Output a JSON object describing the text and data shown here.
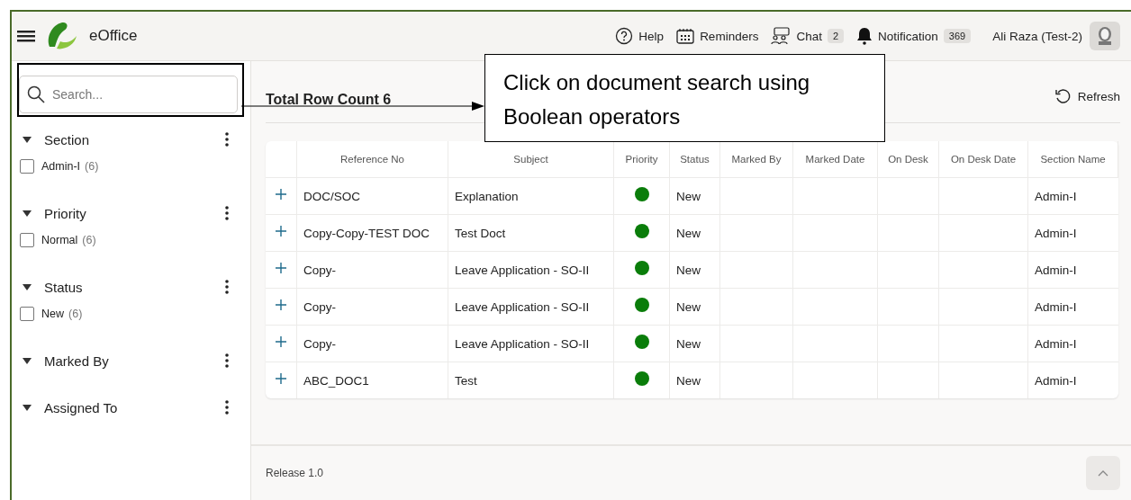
{
  "header": {
    "app_name": "eOffice",
    "nav": [
      {
        "kind": "help",
        "label": "Help"
      },
      {
        "kind": "reminders",
        "label": "Reminders"
      },
      {
        "kind": "chat",
        "label": "Chat",
        "badge": "2"
      },
      {
        "kind": "notification",
        "label": "Notification",
        "badge": "369"
      }
    ],
    "user": "Ali Raza (Test-2)"
  },
  "search": {
    "placeholder": "Search..."
  },
  "filters": [
    {
      "title": "Section",
      "expanded": true,
      "options": [
        {
          "label": "Admin-I",
          "count": "(6)",
          "checked": false
        }
      ]
    },
    {
      "title": "Priority",
      "expanded": true,
      "options": [
        {
          "label": "Normal",
          "count": "(6)",
          "checked": false
        }
      ]
    },
    {
      "title": "Status",
      "expanded": true,
      "options": [
        {
          "label": "New",
          "count": "(6)",
          "checked": false
        }
      ]
    },
    {
      "title": "Marked By",
      "expanded": true
    },
    {
      "title": "Assigned To",
      "expanded": true
    }
  ],
  "results": {
    "title": "Total Row Count 6",
    "refresh": "Refresh"
  },
  "table": {
    "columns": [
      "Reference No",
      "Subject",
      "Priority",
      "Status",
      "Marked By",
      "Marked Date",
      "On Desk",
      "On Desk Date",
      "Section Name"
    ],
    "rows": [
      {
        "reference_no": "DOC/SOC",
        "subject": "Explanation",
        "color": "#0a7d0a",
        "status": "New",
        "section_name": "Admin-I"
      },
      {
        "reference_no": "Copy-Copy-TEST DOC",
        "subject": "Test Doct",
        "color": "#0a7d0a",
        "status": "New",
        "section_name": "Admin-I"
      },
      {
        "reference_no": "Copy-",
        "subject": "Leave Application - SO-II",
        "color": "#0a7d0a",
        "status": "New",
        "section_name": "Admin-I"
      },
      {
        "reference_no": "Copy-",
        "subject": "Leave Application - SO-II",
        "color": "#0a7d0a",
        "status": "New",
        "section_name": "Admin-I"
      },
      {
        "reference_no": "Copy-",
        "subject": "Leave Application - SO-II",
        "color": "#0a7d0a",
        "status": "New",
        "section_name": "Admin-I"
      },
      {
        "reference_no": "ABC_DOC1",
        "subject": "Test",
        "color": "#0a7d0a",
        "status": "New",
        "section_name": "Admin-I"
      }
    ]
  },
  "footer": {
    "release": "Release 1.0"
  },
  "annotation": {
    "lines": [
      "Click on document search using",
      "Boolean operators"
    ]
  }
}
